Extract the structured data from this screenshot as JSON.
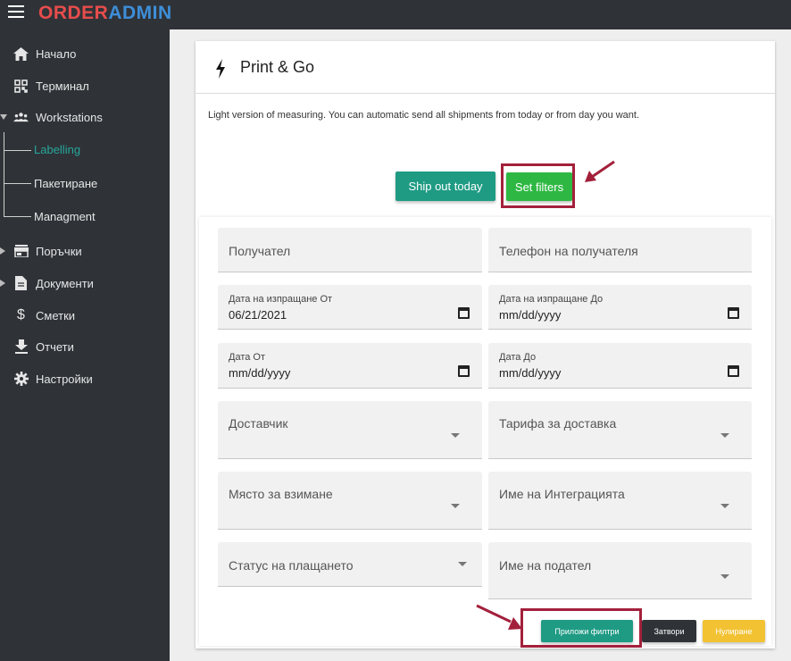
{
  "app": {
    "logo_part1": "ORDER",
    "logo_part2": "ADMIN"
  },
  "sidebar": {
    "items": [
      {
        "label": "Начало",
        "icon": "home-icon"
      },
      {
        "label": "Терминал",
        "icon": "qr-code-icon"
      },
      {
        "label": "Workstations",
        "icon": "people-icon",
        "expanded": true
      },
      {
        "label": "Поръчки",
        "icon": "store-icon"
      },
      {
        "label": "Документи",
        "icon": "document-icon"
      },
      {
        "label": "Сметки",
        "icon": "dollar-icon"
      },
      {
        "label": "Отчети",
        "icon": "download-icon"
      },
      {
        "label": "Настройки",
        "icon": "gear-icon"
      }
    ],
    "workstations_sub": [
      {
        "label": "Labelling",
        "active": true
      },
      {
        "label": "Пакетиране"
      },
      {
        "label": "Managment"
      }
    ]
  },
  "card": {
    "title": "Print & Go",
    "description": "Light version of measuring. You can automatic send all shipments from today or from day you want.",
    "ship_out_label": "Ship out today",
    "set_filters_label": "Set filters"
  },
  "filters": {
    "recipient_placeholder": "Получател",
    "recipient_phone_placeholder": "Телефон на получателя",
    "shipping_date_from_label": "Дата на изпращане От",
    "shipping_date_from_value": "06/21/2021",
    "shipping_date_to_label": "Дата на изпращане До",
    "shipping_date_to_value": "mm/dd/yyyy",
    "date_from_label": "Дата От",
    "date_from_value": "mm/dd/yyyy",
    "date_to_label": "Дата До",
    "date_to_value": "mm/dd/yyyy",
    "carrier_placeholder": "Доставчик",
    "shipping_rate_placeholder": "Тарифа за доставка",
    "pickup_place_placeholder": "Място за взимане",
    "integration_name_placeholder": "Име на Интеграцията",
    "payment_status_placeholder": "Статус на плащането",
    "sender_name_placeholder": "Име на подател",
    "apply_label": "Приложи филтри",
    "close_label": "Затвори",
    "reset_label": "Нулиране"
  },
  "colors": {
    "sidebar_bg": "#2f3338",
    "accent_teal": "#1f9b84",
    "accent_green": "#2eb843",
    "accent_yellow": "#f2c233",
    "highlight_red": "#a3203b",
    "logo_red": "#e74c4c",
    "logo_blue": "#3e8ed8"
  }
}
